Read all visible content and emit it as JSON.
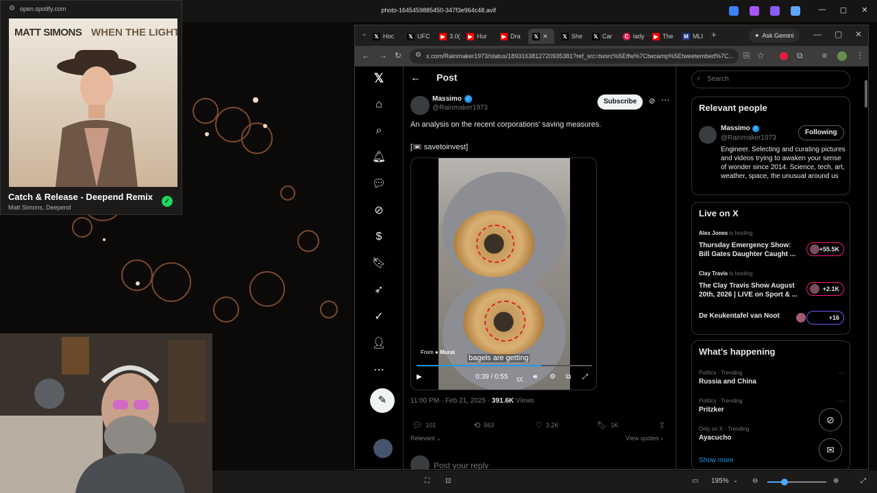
{
  "viewer": {
    "title": "photo-1645459885450-347f3e964c48.avif",
    "zoom": "195%",
    "win_min": "—",
    "win_max": "▢",
    "win_close": "✕"
  },
  "spotify": {
    "url": "open.spotify.com",
    "album_artist": "MATT SIMONS",
    "album_title": "WHEN THE LIGHTS GO DOWN",
    "track": "Catch & Release - Deepend Remix",
    "artists": "Matt Simons, Deepend"
  },
  "browser": {
    "tabs": [
      {
        "icon": "x-icon",
        "label": "Hoc"
      },
      {
        "icon": "x-icon",
        "label": "UFC"
      },
      {
        "icon": "youtube-icon",
        "label": "3.0("
      },
      {
        "icon": "youtube-icon",
        "label": "Hur"
      },
      {
        "icon": "youtube-icon",
        "label": "Dra"
      },
      {
        "icon": "x-icon",
        "label": ""
      },
      {
        "icon": "x-icon",
        "label": "She"
      },
      {
        "icon": "x-icon",
        "label": "Car"
      },
      {
        "icon": "generic-icon",
        "label": "lady"
      },
      {
        "icon": "youtube-icon",
        "label": "The"
      },
      {
        "icon": "mlb-icon",
        "label": "MLI"
      }
    ],
    "new_tab": "+",
    "gemini_label": "Ask Gemini",
    "url": "x.com/Rainmaker1973/status/1893163812720935381?ref_src=twsrc%5Etfw%7Ctwcamp%5Etweetembed%7C..."
  },
  "post": {
    "header": "Post",
    "author_name": "Massimo",
    "author_handle": "@Rainmaker1973",
    "subscribe": "Subscribe",
    "text": "An analysis on the recent corporations' saving measures.",
    "tag": "[📼 savetoinvest]",
    "video": {
      "from_label": "From",
      "from_user": "Murat",
      "subtitle": "bagels are getting",
      "time": "0:39 / 0:55",
      "progress": 0.71
    },
    "timestamp": "11:00 PM · Feb 21, 2025 · ",
    "views_count": "391.6K",
    "views_label": " Views",
    "replies": "101",
    "reposts": "563",
    "likes": "3.2K",
    "bookmarks": "1K",
    "relevant": "Relevant ⌄",
    "view_quotes": "View quotes ›",
    "reply_placeholder": "Post your reply"
  },
  "sidebar": {
    "search_placeholder": "Search",
    "relevant_title": "Relevant people",
    "person_name": "Massimo",
    "person_handle": "@Rainmaker1973",
    "following": "Following",
    "bio": "Engineer. Selecting and curating pictures and videos trying to awaken your sense of wonder since 2014. Science, tech, art, weather, space, the unusual around us",
    "live_title": "Live on X",
    "live": [
      {
        "host": "Alex Jones",
        "hosting": " is hosting",
        "title": "Thursday Emergency Show: Bill Gates Daughter Caught ...",
        "count": "+55.5K"
      },
      {
        "host": "Clay Travis",
        "hosting": " is hosting",
        "title": "The Clay Travis Show August 20th, 2026 | LIVE on Sport & ...",
        "count": "+2.1K"
      },
      {
        "host": "",
        "hosting": "",
        "title": "De Keukentafel van Noot",
        "count": "+16"
      }
    ],
    "happening_title": "What’s happening",
    "trends": [
      {
        "category": "Politics · Trending",
        "name": "Russia and China"
      },
      {
        "category": "Politics · Trending",
        "name": "Pritzker"
      },
      {
        "category": "Only on X · Trending",
        "name": "Ayacucho"
      }
    ],
    "show_more": "Show more"
  }
}
